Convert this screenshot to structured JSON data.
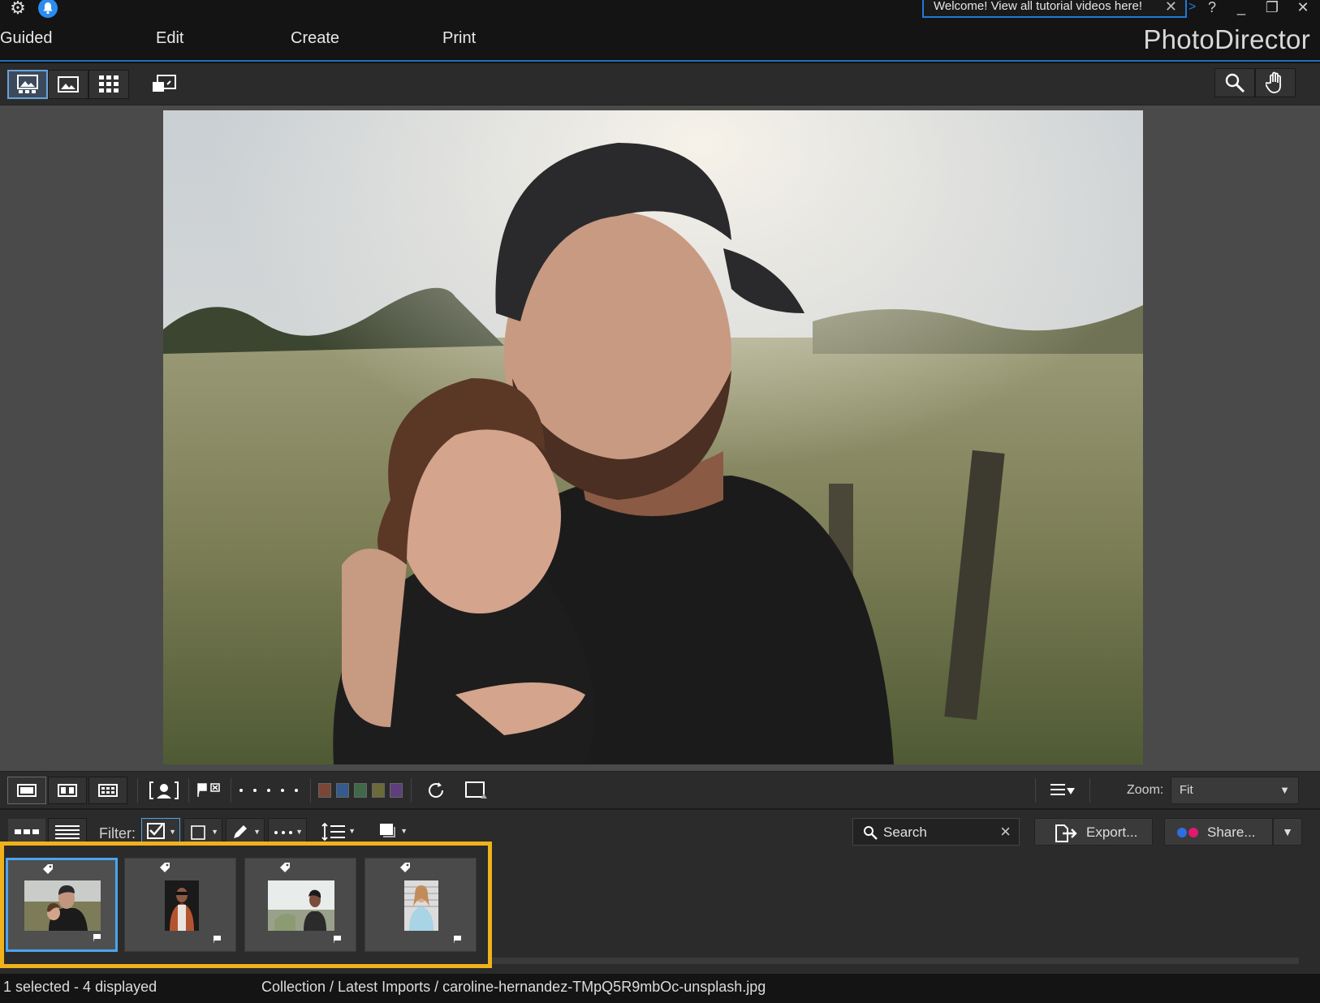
{
  "notification": {
    "text": "Welcome! View all tutorial videos here!"
  },
  "menu": {
    "items": [
      "Guided",
      "Edit",
      "Create",
      "Print"
    ]
  },
  "app": {
    "brand": "PhotoDirector"
  },
  "zoom": {
    "label": "Zoom:",
    "value": "Fit"
  },
  "filter": {
    "label": "Filter:"
  },
  "search": {
    "placeholder": "Search"
  },
  "actions": {
    "export_label": "Export...",
    "share_label": "Share..."
  },
  "color_labels": [
    "#7a4636",
    "#355a8c",
    "#3f6a4a",
    "#6b6a3a",
    "#5e3f7e"
  ],
  "thumbnails": [
    {
      "selected": true
    },
    {
      "selected": false
    },
    {
      "selected": false
    },
    {
      "selected": false
    }
  ],
  "status": {
    "count": "1 selected - 4 displayed",
    "path": "Collection / Latest Imports / caroline-hernandez-TMpQ5R9mbOc-unsplash.jpg"
  },
  "colors": {
    "accent": "#1f7ad8",
    "highlight": "#f0b21a",
    "selection": "#4ba4ee"
  }
}
